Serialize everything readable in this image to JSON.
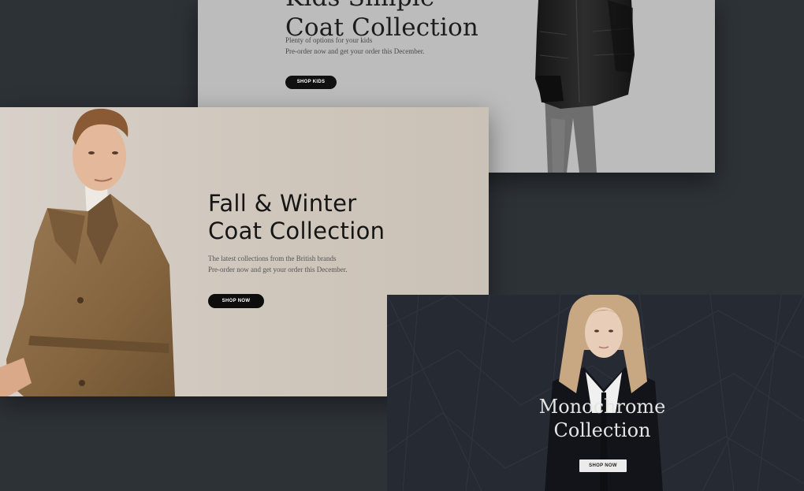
{
  "kids_banner": {
    "title_line1": "Kids Simple",
    "title_line2": "Coat Collection",
    "desc_line1": "Plenty of options for your kids",
    "desc_line2": "Pre-order now and get your order this December.",
    "button_label": "SHOP KIDS",
    "background": "#bcbcbc"
  },
  "fall_banner": {
    "title_line1": "Fall & Winter",
    "title_line2": "Coat Collection",
    "desc_line1": "The latest collections from the British brands",
    "desc_line2": "Pre-order now and get your order this December.",
    "button_label": "SHOP NOW",
    "background": "#d3cbc1",
    "coat_color": "#8b6a47"
  },
  "mono_banner": {
    "title_line1": "Monochrome",
    "title_line2": "Collection",
    "button_label": "SHOP NOW",
    "background": "#262a33"
  },
  "page_background": "#2d3237",
  "icons": [
    "kids-model-photo",
    "fall-model-photo",
    "mono-model-photo",
    "geometric-pattern"
  ]
}
